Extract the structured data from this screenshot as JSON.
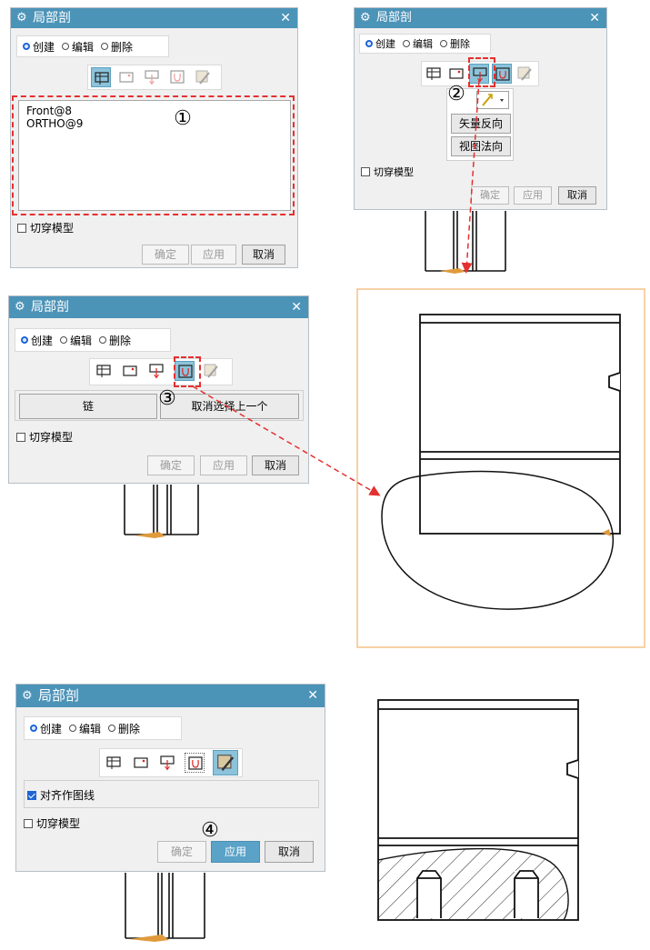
{
  "dialog_title": "局部剖",
  "close_glyph": "✕",
  "gear_glyph": "⚙",
  "radio_labels": {
    "create": "创建",
    "edit": "编辑",
    "delete": "删除"
  },
  "buttons": {
    "ok": "确定",
    "apply": "应用",
    "cancel": "取消"
  },
  "cut_through_label": "切穿模型",
  "step1": {
    "badge": "①",
    "view_list": [
      "Front@8",
      "ORTHO@9"
    ]
  },
  "step2": {
    "badge": "②",
    "options": {
      "reverse_vector": "矢量反向",
      "view_normal": "视图法向"
    }
  },
  "step3": {
    "badge": "③",
    "chain_button": "链",
    "deselect_button": "取消选择上一个"
  },
  "step4": {
    "badge": "④",
    "align_label": "对齐作图线"
  },
  "icons": [
    "select-view-icon",
    "base-point-icon",
    "extrude-vector-icon",
    "select-curve-icon",
    "modify-boundary-icon"
  ],
  "colors": {
    "titlebar": "#4c93b8",
    "active_icon": "#8cc3da",
    "dash": "#e53030",
    "primary": "#5aa2c8",
    "frame": "#f5b26b"
  }
}
